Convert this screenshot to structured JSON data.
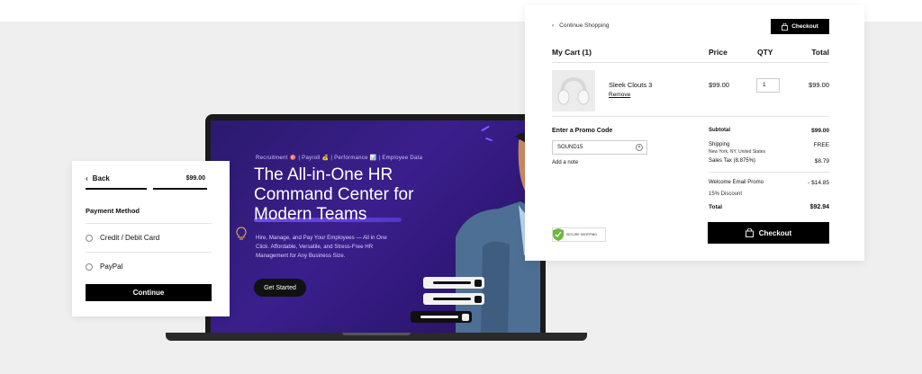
{
  "payment": {
    "back_label": "Back",
    "price": "$99.00",
    "method_title": "Payment Method",
    "options": [
      "Credit / Debit Card",
      "PayPal"
    ],
    "continue_label": "Continue"
  },
  "hero": {
    "tags": "Recruitment 🎯 | Payroll 💰 | Performance 📊 | Employee Data",
    "title": "The All-in-One HR Command Center for Modern Teams",
    "subtitle": "Hire, Manage, and Pay Your Employees — All in One Click. Affordable, Versatile, and Stress-Free HR Management for Any Business Size.",
    "cta_label": "Get Started"
  },
  "cart": {
    "continue_shopping": "Continue Shopping",
    "checkout_top_label": "Checkout",
    "heading": "My Cart (1)",
    "col_price": "Price",
    "col_qty": "QTY",
    "col_total": "Total",
    "item": {
      "name": "Sleek Clouts 3",
      "remove_label": "Remove",
      "price": "$99.00",
      "qty": "1",
      "total": "$99.00"
    },
    "promo_label": "Enter a Promo Code",
    "promo_value": "SOUND15",
    "add_note": "Add a note",
    "secure_badge": "SECURE SHOPPING",
    "summary": {
      "subtotal_label": "Subtotal",
      "subtotal_value": "$99.00",
      "shipping_label": "Shipping",
      "shipping_value": "FREE",
      "shipping_location": "New York, NY, United States",
      "tax_label": "Sales Tax (8.875%)",
      "tax_value": "$8.79",
      "promo_label": "Welcome Email Promo",
      "promo_value": "- $14.85",
      "promo_sub": "15% Discount",
      "total_label": "Total",
      "total_value": "$92.94"
    },
    "checkout_label": "Checkout"
  },
  "colors": {
    "hero_bg": "#3a1f8c",
    "accent": "#7b5cff",
    "black": "#000000"
  }
}
